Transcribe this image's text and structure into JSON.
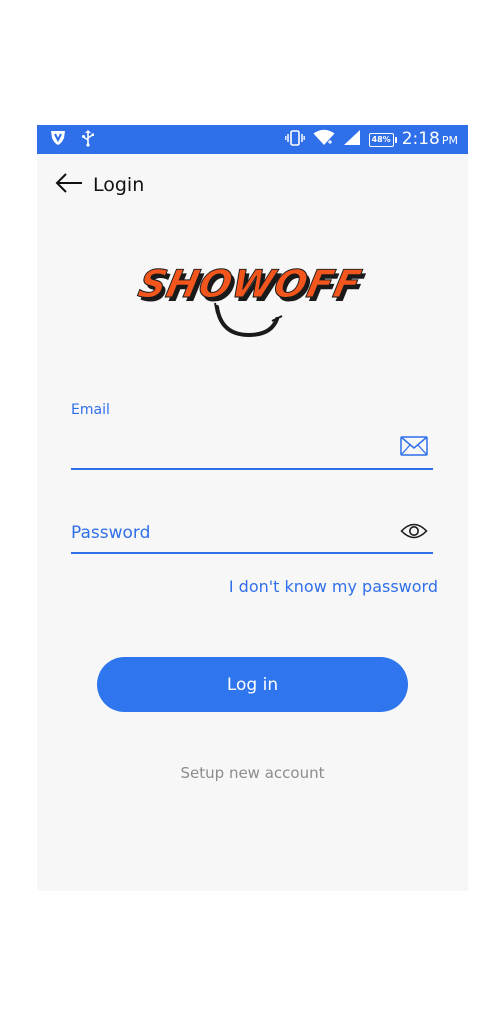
{
  "status_bar": {
    "battery": "48%",
    "time": "2:18",
    "ampm": "PM",
    "icons": [
      "shield-icon",
      "usb-icon",
      "vibrate-icon",
      "wifi-icon",
      "signal-icon",
      "battery-icon"
    ]
  },
  "app_bar": {
    "title": "Login",
    "back_icon": "back-arrow-icon"
  },
  "logo": {
    "text": "SHOWOFF",
    "colors": {
      "fill": "#f2561d",
      "shadow": "#1a1a1a"
    }
  },
  "form": {
    "email": {
      "label": "Email",
      "value": "",
      "icon": "mail-icon"
    },
    "password": {
      "placeholder": "Password",
      "value": "",
      "icon": "eye-icon"
    },
    "forgot_password": "I don't know my password",
    "login_button": "Log in",
    "setup_account": "Setup new account"
  },
  "colors": {
    "accent": "#2f6fea",
    "status_bar": "#2f6fea",
    "background": "#f7f7f7",
    "muted_text": "#8c8c8c"
  }
}
